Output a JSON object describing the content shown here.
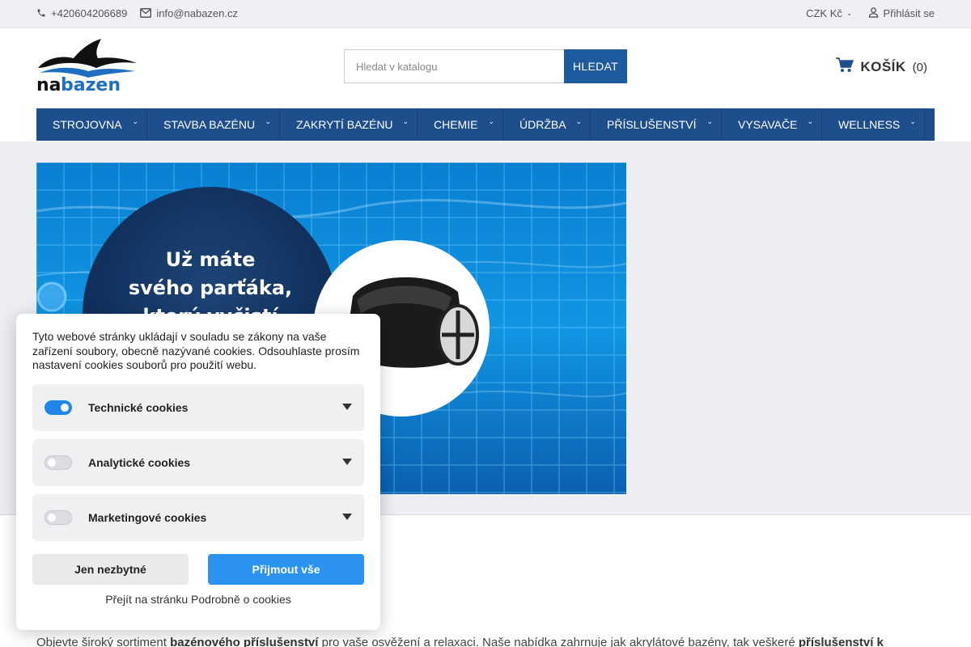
{
  "topbar": {
    "phone": "+420604206689",
    "email": "info@nabazen.cz",
    "currency": "CZK Kč",
    "login": "Přihlásit se"
  },
  "logo": {
    "text": "nabazen",
    "colors": {
      "dark": "#111111",
      "blue": "#1e6fc0"
    }
  },
  "search": {
    "placeholder": "Hledat v katalogu",
    "button": "HLEDAT"
  },
  "cart": {
    "label": "KOŠÍK",
    "count": "(0)"
  },
  "nav": {
    "items": [
      {
        "label": "STROJOVNA"
      },
      {
        "label": "STAVBA BAZÉNU"
      },
      {
        "label": "ZAKRYTÍ BAZÉNU"
      },
      {
        "label": "CHEMIE"
      },
      {
        "label": "ÚDRŽBA"
      },
      {
        "label": "PŘÍSLUŠENSTVÍ"
      },
      {
        "label": "VYSAVAČE"
      },
      {
        "label": "WELLNESS"
      }
    ]
  },
  "banner": {
    "line1": "Už máte",
    "line2": "svého parťáka,",
    "line3": "který vyčistí"
  },
  "intro": {
    "t1": "Objevte široký sortiment ",
    "b1": "bazénového příslušenství",
    "t2": " pro vaše osvěžení a relaxaci. Naše nabídka zahrnuje jak akrylátové bazény, tak veškeré ",
    "b2": "příslušenství k"
  },
  "cookies": {
    "text": "Tyto webové stránky ukládají v souladu se zákony na vaše zařízení soubory, obecně nazývané cookies. Odsouhlaste prosím nastavení cookies souborů pro použití webu.",
    "categories": [
      {
        "label": "Technické cookies",
        "enabled": true
      },
      {
        "label": "Analytické cookies",
        "enabled": false
      },
      {
        "label": "Marketingové cookies",
        "enabled": false
      }
    ],
    "btn_necessary": "Jen nezbytné",
    "btn_accept": "Přijmout vše",
    "details_link": "Přejít na stránku Podrobně o cookies"
  },
  "colors": {
    "accent": "#1e4f8c",
    "accent_button": "#2b94ee",
    "topbar_bg": "#eef0f4"
  }
}
